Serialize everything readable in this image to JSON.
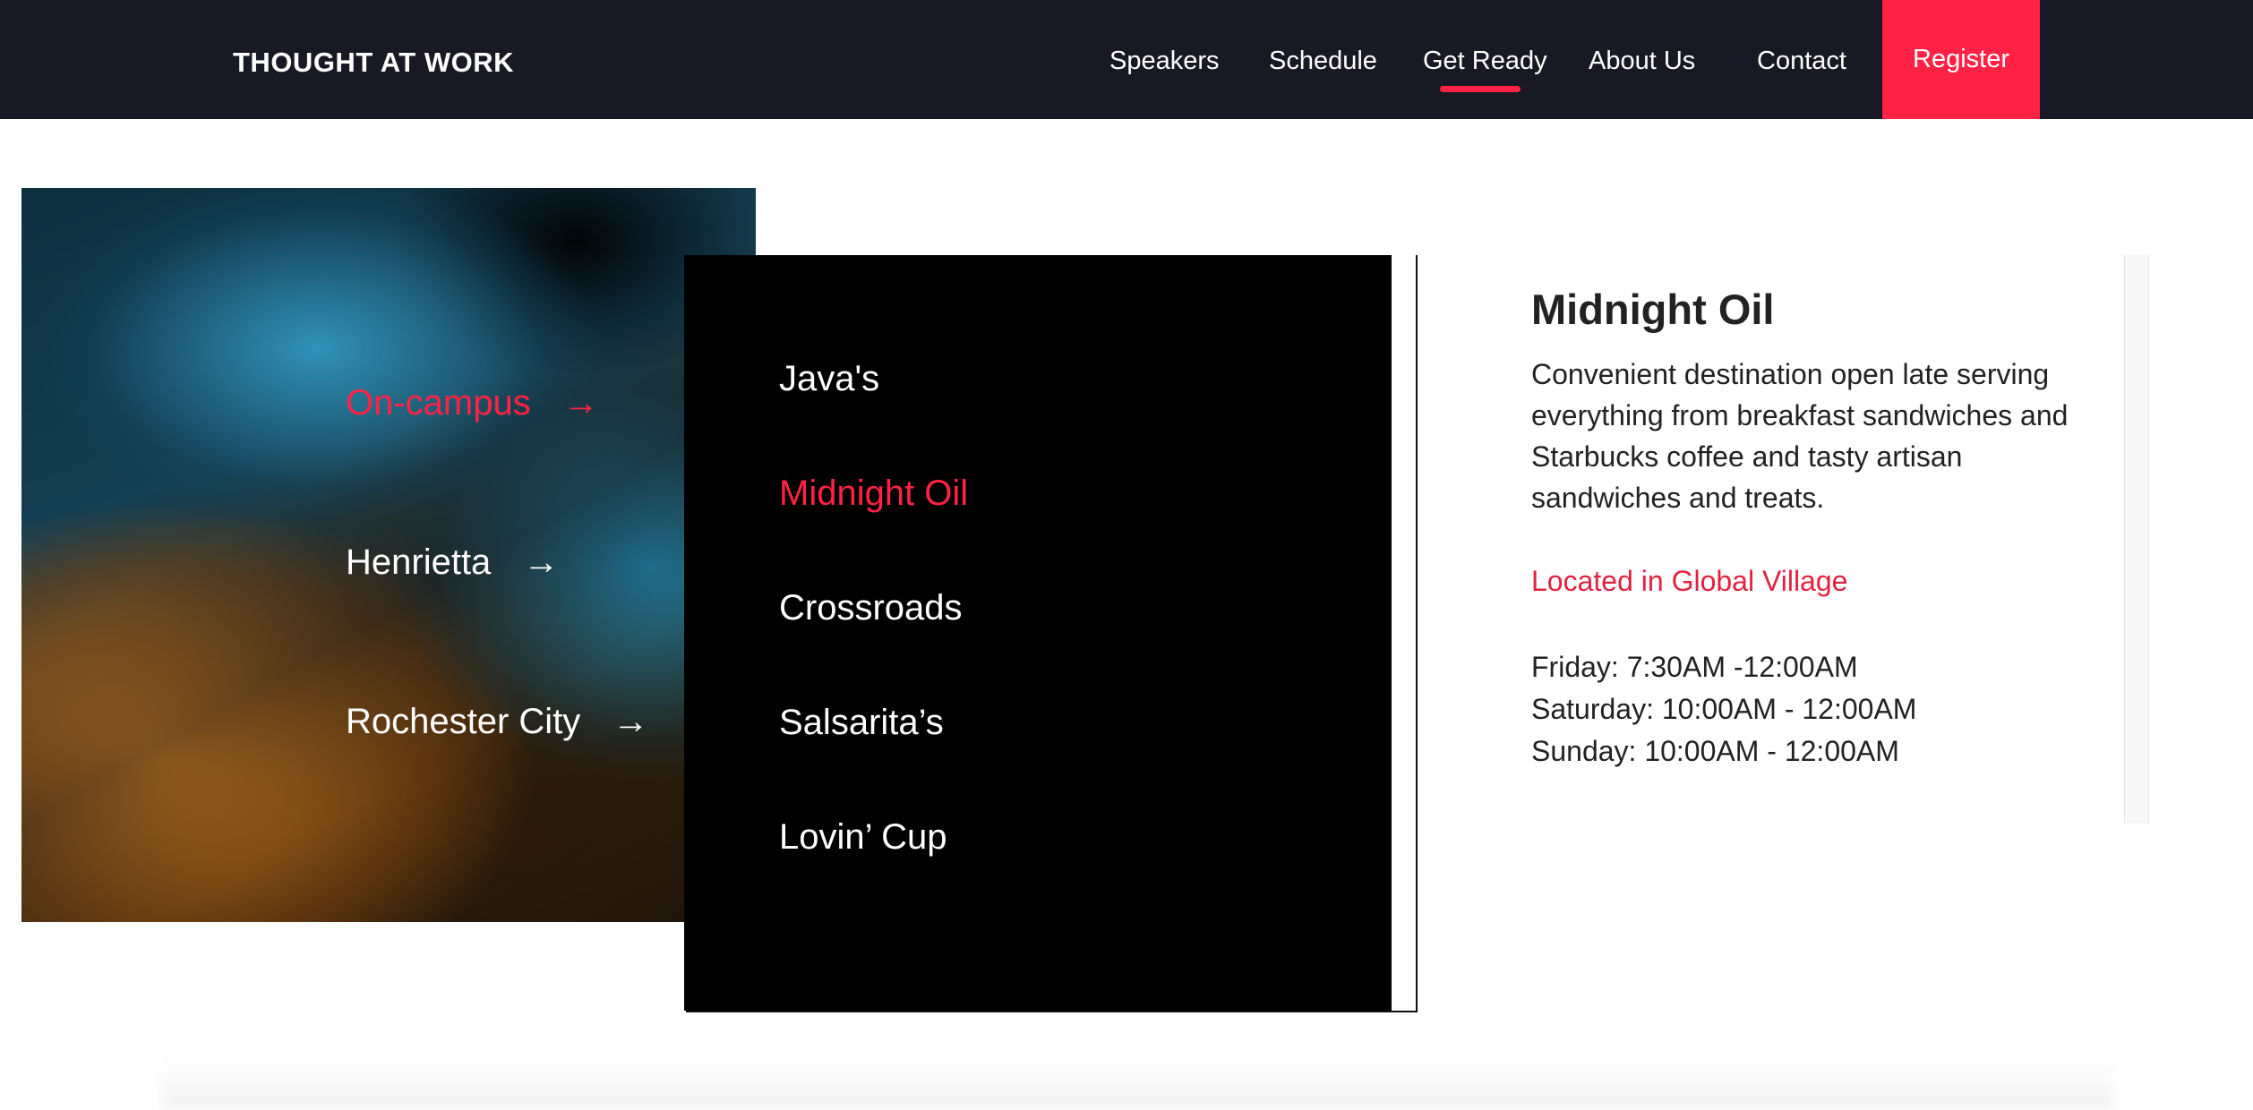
{
  "header": {
    "brand": "THOUGHT AT WORK",
    "nav": [
      {
        "label": "Speakers"
      },
      {
        "label": "Schedule"
      },
      {
        "label": "Get Ready"
      },
      {
        "label": "About Us"
      },
      {
        "label": "Contact"
      }
    ],
    "active_nav": "Get Ready",
    "register_label": "Register"
  },
  "locations": [
    {
      "label": "On-campus",
      "active": true
    },
    {
      "label": "Henrietta",
      "active": false
    },
    {
      "label": "Rochester City",
      "active": false
    }
  ],
  "arrow_icon": "arrow-right-icon",
  "venues": [
    {
      "label": "Java's"
    },
    {
      "label": "Midnight Oil"
    },
    {
      "label": "Crossroads"
    },
    {
      "label": "Salsarita’s"
    },
    {
      "label": "Lovin’ Cup"
    }
  ],
  "active_venue": "Midnight Oil",
  "detail": {
    "title": "Midnight Oil",
    "description": "Convenient destination open late serving everything from breakfast sandwiches and Starbucks coffee and tasty artisan sandwiches and treats.",
    "location_text": "Located in Global Village",
    "hours": [
      "Friday: 7:30AM -12:00AM",
      "Saturday: 10:00AM - 12:00AM",
      "Sunday: 10:00AM - 12:00AM"
    ]
  },
  "colors": {
    "header_bg": "#181924",
    "accent": "#ff2244",
    "card_bg": "#000000"
  }
}
